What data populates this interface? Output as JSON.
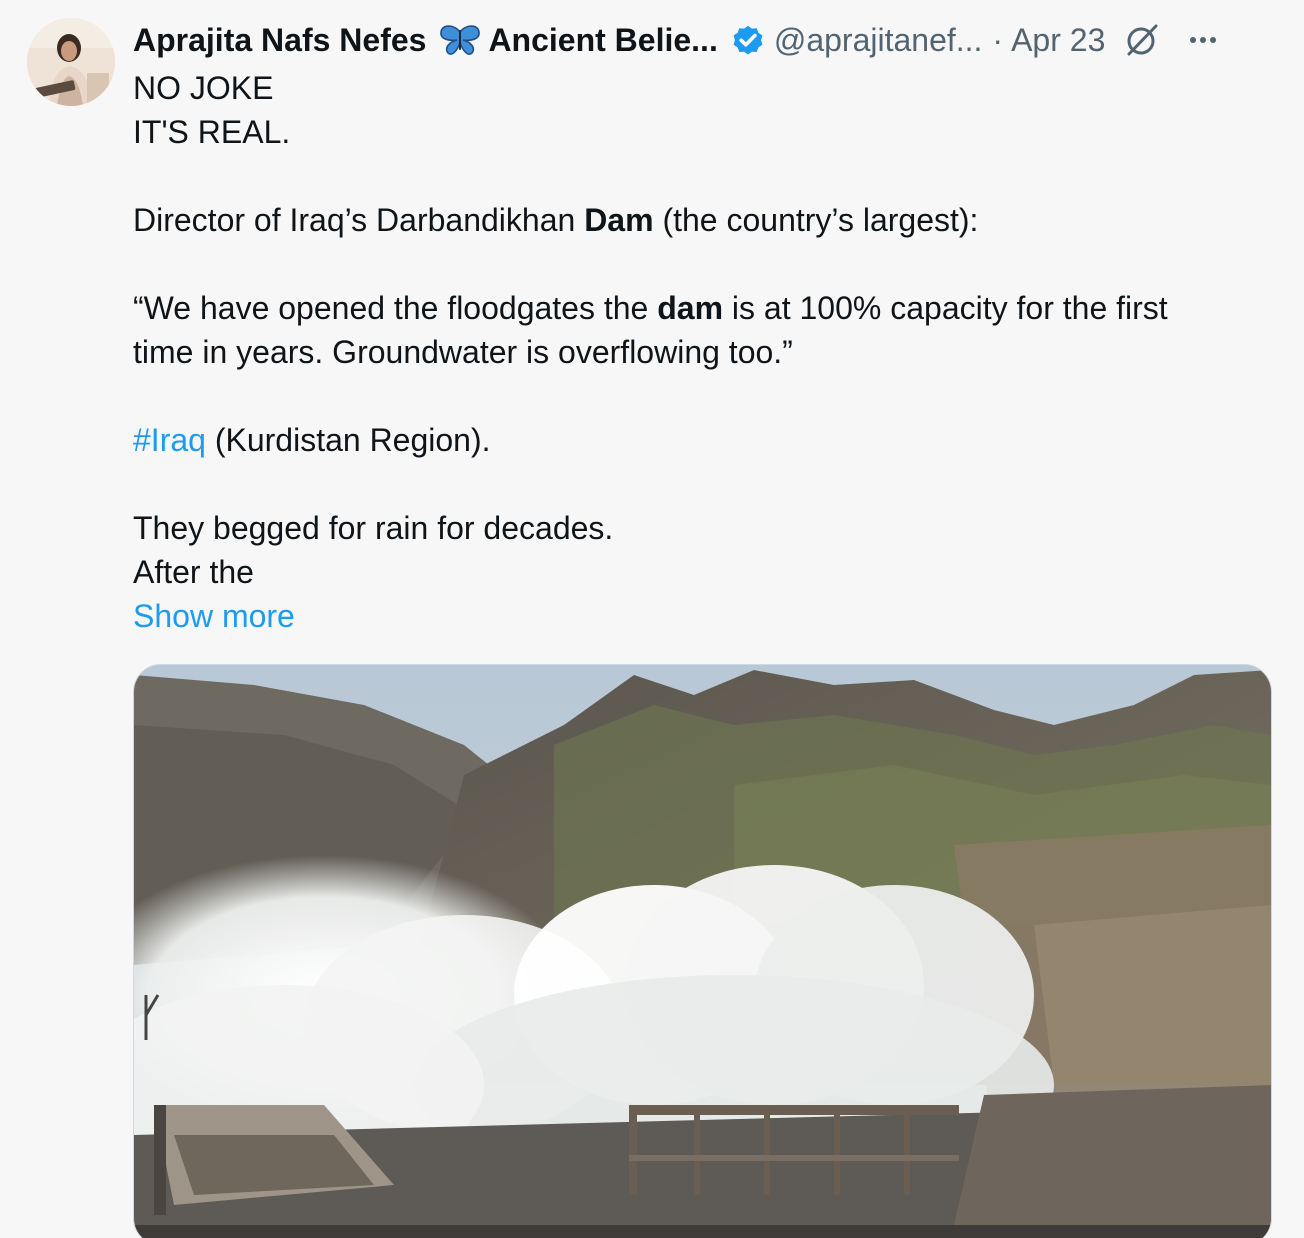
{
  "tweet": {
    "author": {
      "display_name": "Aprajita Nafs Nefes",
      "name_suffix": "Ancient Belie...",
      "emoji_icon": "butterfly-icon",
      "verified": true,
      "handle": "@aprajitanef...",
      "separator": "·",
      "date": "Apr 23"
    },
    "text": {
      "line1": "NO JOKE",
      "line2": "IT'S REAL.",
      "line3_pre": "Director of Iraq’s Darbandikhan ",
      "line3_bold": "Dam",
      "line3_post": " (the country’s largest):",
      "quote1_pre": "“We have opened the floodgates the ",
      "quote1_bold": "dam",
      "quote1_post": " is at 100% capacity for the first",
      "quote2": "time in years. Groundwater is overflowing too.”",
      "hashtag": "#Iraq",
      "hashtag_post": " (Kurdistan Region).",
      "line5": "They begged for rain for decades.",
      "line6": "After the"
    },
    "show_more_label": "Show more",
    "media": {
      "type": "video",
      "subject": "dam-spillway-water-release"
    },
    "colors": {
      "link": "#1d9bf0",
      "verified": "#1d9bf0",
      "secondary_text": "#536471",
      "background": "#f7f7f7"
    }
  }
}
